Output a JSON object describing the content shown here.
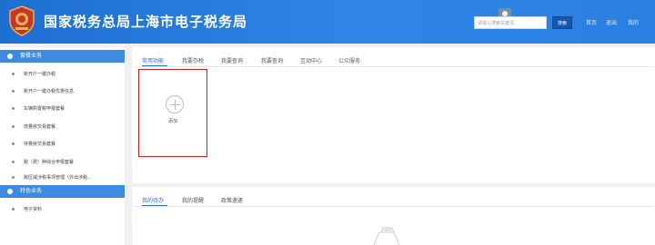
{
  "header": {
    "title": "国家税务总局上海市电子税务局",
    "search_placeholder": "请输入搜索关键词",
    "search_button": "搜索",
    "links": [
      "首页",
      "退出",
      "我的"
    ]
  },
  "sidebar": {
    "section1": {
      "title": "套餐业务",
      "items": [
        "新开户一键办税",
        "新开户一键办税优惠信息",
        "车辆购置税申报套餐",
        "增量房交易套餐",
        "存量房交易套餐",
        "税（费）种综合申报套餐",
        "跨区域涉税事项管理（外出涉税..."
      ]
    },
    "section2": {
      "title": "特色业务",
      "items": [
        "电子资料"
      ]
    }
  },
  "main": {
    "tabs": [
      "常用功能",
      "我要办税",
      "我要查询",
      "我要查询",
      "互动中心",
      "公众服务"
    ],
    "active_tab": 0,
    "add_label": "添加"
  },
  "todo": {
    "tabs": [
      "我的待办",
      "我的提醒",
      "政策速递"
    ],
    "active_tab": 0
  },
  "colors": {
    "header": "#2a7fe0",
    "accent": "#2d6fd0",
    "highlight": "#d11f2a"
  },
  "icons": [
    "tax-emblem-icon",
    "user-icon",
    "plus-icon",
    "empty-inbox-icon"
  ]
}
